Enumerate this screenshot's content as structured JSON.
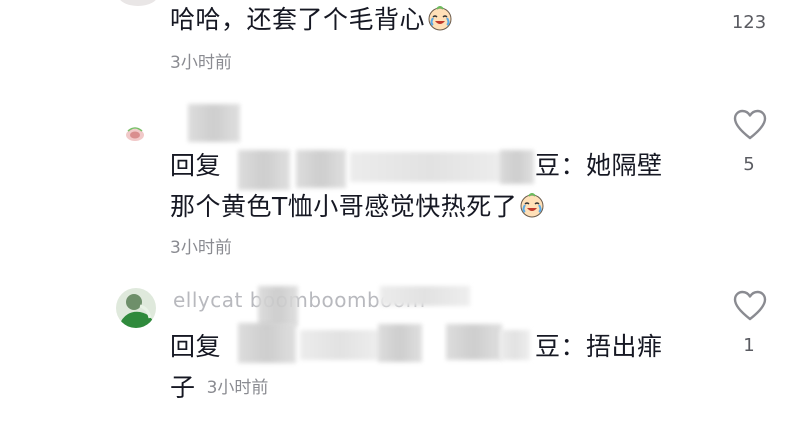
{
  "comments": [
    {
      "text": "哈哈，还套了个毛背心",
      "emoji": "crying-laughing-emoji",
      "time": "3小时前",
      "likes": "123"
    },
    {
      "reply_prefix": "回复",
      "name_tail": "豆",
      "text_line1": "：她隔壁",
      "text_line2": "那个黄色T恤小哥感觉快热死了",
      "emoji": "crying-laughing-emoji",
      "time": "3小时前",
      "likes": "5"
    },
    {
      "username": "ellycat boomboomboom",
      "reply_prefix": "回复",
      "name_tail": "豆",
      "text_line1": "：捂出痱",
      "text_line2": "子",
      "time": "3小时前",
      "likes": "1"
    }
  ],
  "icons": {
    "like": "heart-outline-icon"
  },
  "colors": {
    "text": "#161823",
    "muted": "#8a8b91"
  }
}
